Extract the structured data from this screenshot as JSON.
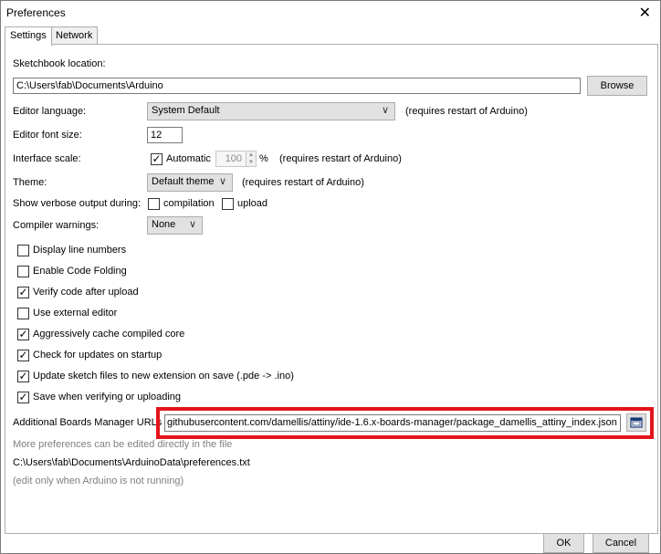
{
  "window": {
    "title": "Preferences",
    "close_glyph": "✕"
  },
  "tabs": [
    {
      "label": "Settings"
    },
    {
      "label": "Network"
    }
  ],
  "sketchbook": {
    "label": "Sketchbook location:",
    "value": "C:\\Users\\fab\\Documents\\Arduino",
    "browse_label": "Browse"
  },
  "language": {
    "label": "Editor language:",
    "value": "System Default",
    "note": "(requires restart of Arduino)"
  },
  "font_size": {
    "label": "Editor font size:",
    "value": "12"
  },
  "scale": {
    "label": "Interface scale:",
    "automatic_label": "Automatic",
    "automatic_checked": true,
    "value": "100",
    "unit": "%",
    "note": "(requires restart of Arduino)"
  },
  "theme": {
    "label": "Theme:",
    "value": "Default theme",
    "note": "(requires restart of Arduino)"
  },
  "verbose": {
    "label": "Show verbose output during:",
    "compilation_label": "compilation",
    "upload_label": "upload"
  },
  "warnings": {
    "label": "Compiler warnings:",
    "value": "None"
  },
  "options": [
    {
      "label": "Display line numbers",
      "checked": false
    },
    {
      "label": "Enable Code Folding",
      "checked": false
    },
    {
      "label": "Verify code after upload",
      "checked": true
    },
    {
      "label": "Use external editor",
      "checked": false
    },
    {
      "label": "Aggressively cache compiled core",
      "checked": true
    },
    {
      "label": "Check for updates on startup",
      "checked": true
    },
    {
      "label": "Update sketch files to new extension on save (.pde -> .ino)",
      "checked": true
    },
    {
      "label": "Save when verifying or uploading",
      "checked": true
    }
  ],
  "boards": {
    "label": "Additional Boards Manager URLs",
    "value": "githubusercontent.com/damellis/attiny/ide-1.6.x-boards-manager/package_damellis_attiny_index.json"
  },
  "footer": {
    "more_text": "More preferences can be edited directly in the file",
    "path": "C:\\Users\\fab\\Documents\\ArduinoData\\preferences.txt",
    "note": "(edit only when Arduino is not running)"
  },
  "buttons": {
    "ok": "OK",
    "cancel": "Cancel"
  },
  "colors": {
    "highlight": "#e3141b"
  }
}
